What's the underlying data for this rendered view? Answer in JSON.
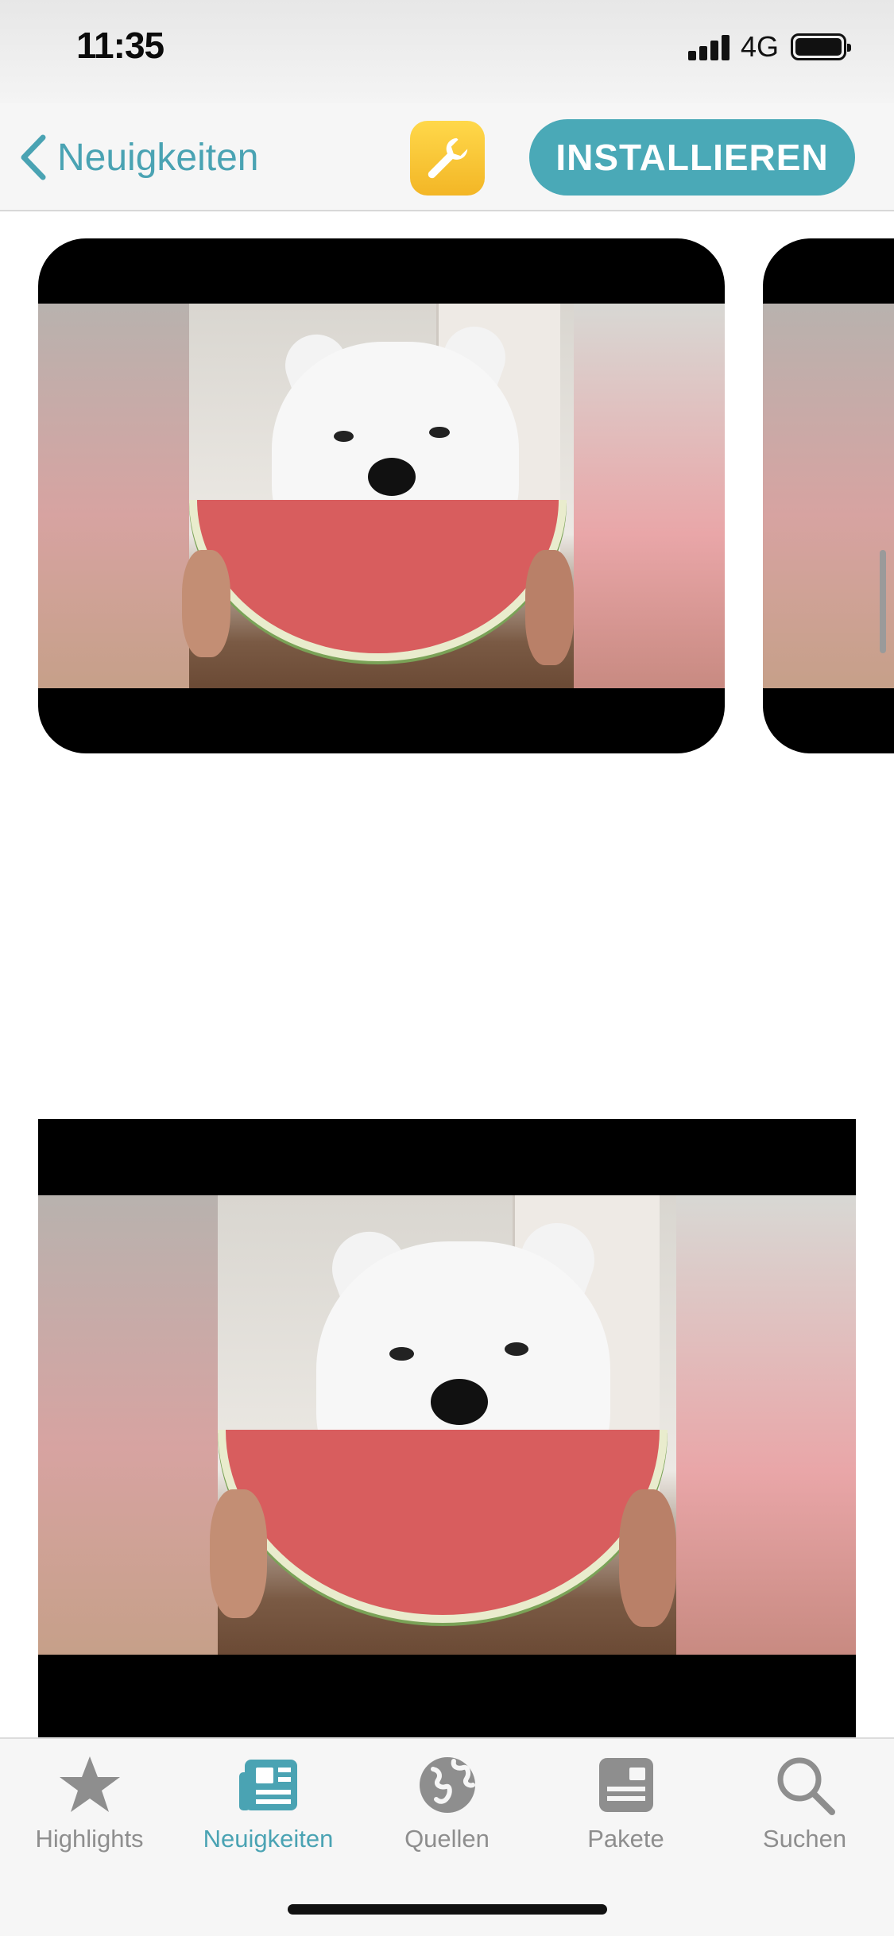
{
  "status_bar": {
    "time": "11:35",
    "network": "4G"
  },
  "nav": {
    "back_label": "Neuigkeiten",
    "install_label": "INSTALLIEREN",
    "app_icon": "wrench-icon",
    "accent_color": "#4aa9b7"
  },
  "screenshots": [
    {
      "subject": "dog-eating-watermelon"
    },
    {
      "subject": "dog-eating-watermelon"
    }
  ],
  "tabbar": {
    "active_tab": "Neuigkeiten",
    "tabs": [
      {
        "label": "Highlights",
        "icon": "star-icon"
      },
      {
        "label": "Neuigkeiten",
        "icon": "news-icon"
      },
      {
        "label": "Quellen",
        "icon": "globe-icon"
      },
      {
        "label": "Pakete",
        "icon": "package-icon"
      },
      {
        "label": "Suchen",
        "icon": "search-icon"
      }
    ]
  }
}
